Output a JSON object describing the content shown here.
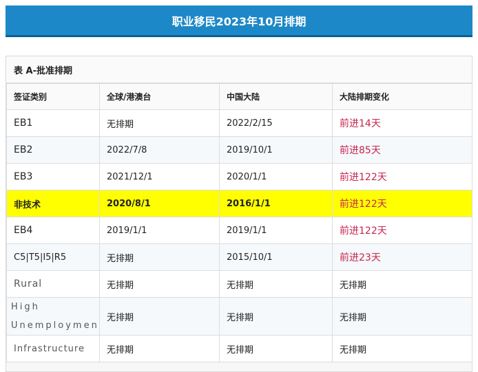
{
  "banner": {
    "title": "职业移民2023年10月排期"
  },
  "table": {
    "caption": "表 A-批准排期",
    "headers": [
      "签证类别",
      "全球/港澳台",
      "中国大陆",
      "大陆排期变化"
    ],
    "rows": [
      {
        "category": "EB1",
        "global": "无排期",
        "china": "2022/2/15",
        "change": "前进14天"
      },
      {
        "category": "EB2",
        "global": "2022/7/8",
        "china": "2019/10/1",
        "change": "前进85天"
      },
      {
        "category": "EB3",
        "global": "2021/12/1",
        "china": "2020/1/1",
        "change": "前进122天"
      },
      {
        "category": "非技术",
        "global": "2020/8/1",
        "china": "2016/1/1",
        "change": "前进122天"
      },
      {
        "category": "EB4",
        "global": "2019/1/1",
        "china": "2019/1/1",
        "change": "前进122天"
      },
      {
        "category": "C5|T5|I5|R5",
        "global": "无排期",
        "china": "2015/10/1",
        "change": "前进23天"
      },
      {
        "category": "Rural",
        "global": "无排期",
        "china": "无排期",
        "change": "无排期"
      },
      {
        "category": "High Unemployment",
        "global": "无排期",
        "china": "无排期",
        "change": "无排期"
      },
      {
        "category": "Infrastructure",
        "global": "无排期",
        "china": "无排期",
        "change": "无排期"
      }
    ]
  },
  "colors": {
    "banner": "#1d88c7",
    "highlight": "#ffff00",
    "change_text": "#c7254e"
  }
}
